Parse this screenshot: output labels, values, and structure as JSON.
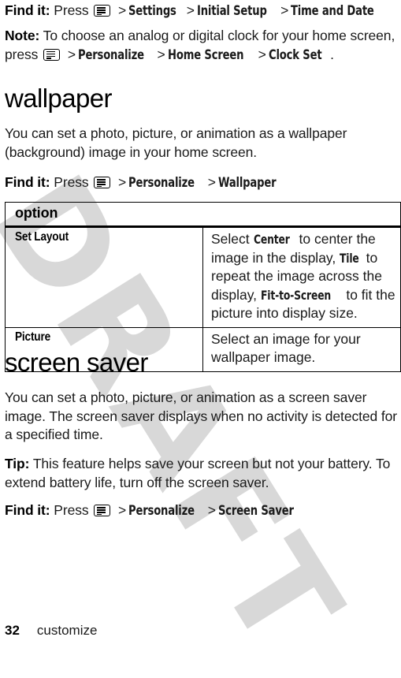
{
  "watermark": {
    "text": "DRAFT"
  },
  "blocks": {
    "find_it_label": "Find it:",
    "press_label": "Press",
    "note_label": "Note:",
    "tip_label": "Tip:",
    "arrow": ">"
  },
  "findit_time_and_date": {
    "label": "Find it:",
    "press": "Press",
    "icon": "menu-key-icon",
    "path": [
      "Settings",
      "Initial Setup",
      "Time and Date"
    ]
  },
  "note_clock": {
    "label": "Note:",
    "text_before": "To choose an analog or digital clock for your home screen, press",
    "icon": "menu-key-icon",
    "path": [
      "Personalize",
      "Home Screen",
      "Clock Set"
    ],
    "text_after": "."
  },
  "wallpaper_section": {
    "heading": "wallpaper",
    "paragraph": "You can set a photo, picture, or animation as a wallpaper (background) image in your home screen.",
    "findit": {
      "label": "Find it:",
      "press": "Press",
      "icon": "menu-key-icon",
      "path": [
        "Personalize",
        "Wallpaper"
      ]
    },
    "table": {
      "header": "option",
      "rows": [
        {
          "key": "Set Layout",
          "value_parts": [
            {
              "type": "text",
              "text": "Select "
            },
            {
              "type": "menu",
              "text": "Center"
            },
            {
              "type": "text",
              "text": " to center the image in the display, "
            },
            {
              "type": "menu",
              "text": "Tile"
            },
            {
              "type": "text",
              "text": " to repeat the image across the display, "
            },
            {
              "type": "menu",
              "text": "Fit-to-Screen"
            },
            {
              "type": "text",
              "text": " to fit the picture into display size."
            }
          ]
        },
        {
          "key": "Picture",
          "value_parts": [
            {
              "type": "text",
              "text": "Select an image for your wallpaper image."
            }
          ]
        }
      ]
    }
  },
  "screensaver_section": {
    "heading": "screen saver",
    "paragraph": "You can set a photo, picture, or animation as a screen saver image. The screen saver displays when no activity is detected for a specified time.",
    "tip": {
      "label": "Tip:",
      "text": "This feature helps save your screen but not your battery. To extend battery life, turn off the screen saver."
    },
    "findit": {
      "label": "Find it:",
      "press": "Press",
      "icon": "menu-key-icon",
      "path": [
        "Personalize",
        "Screen Saver"
      ]
    }
  },
  "footer": {
    "page_number": "32",
    "chapter": "customize"
  }
}
